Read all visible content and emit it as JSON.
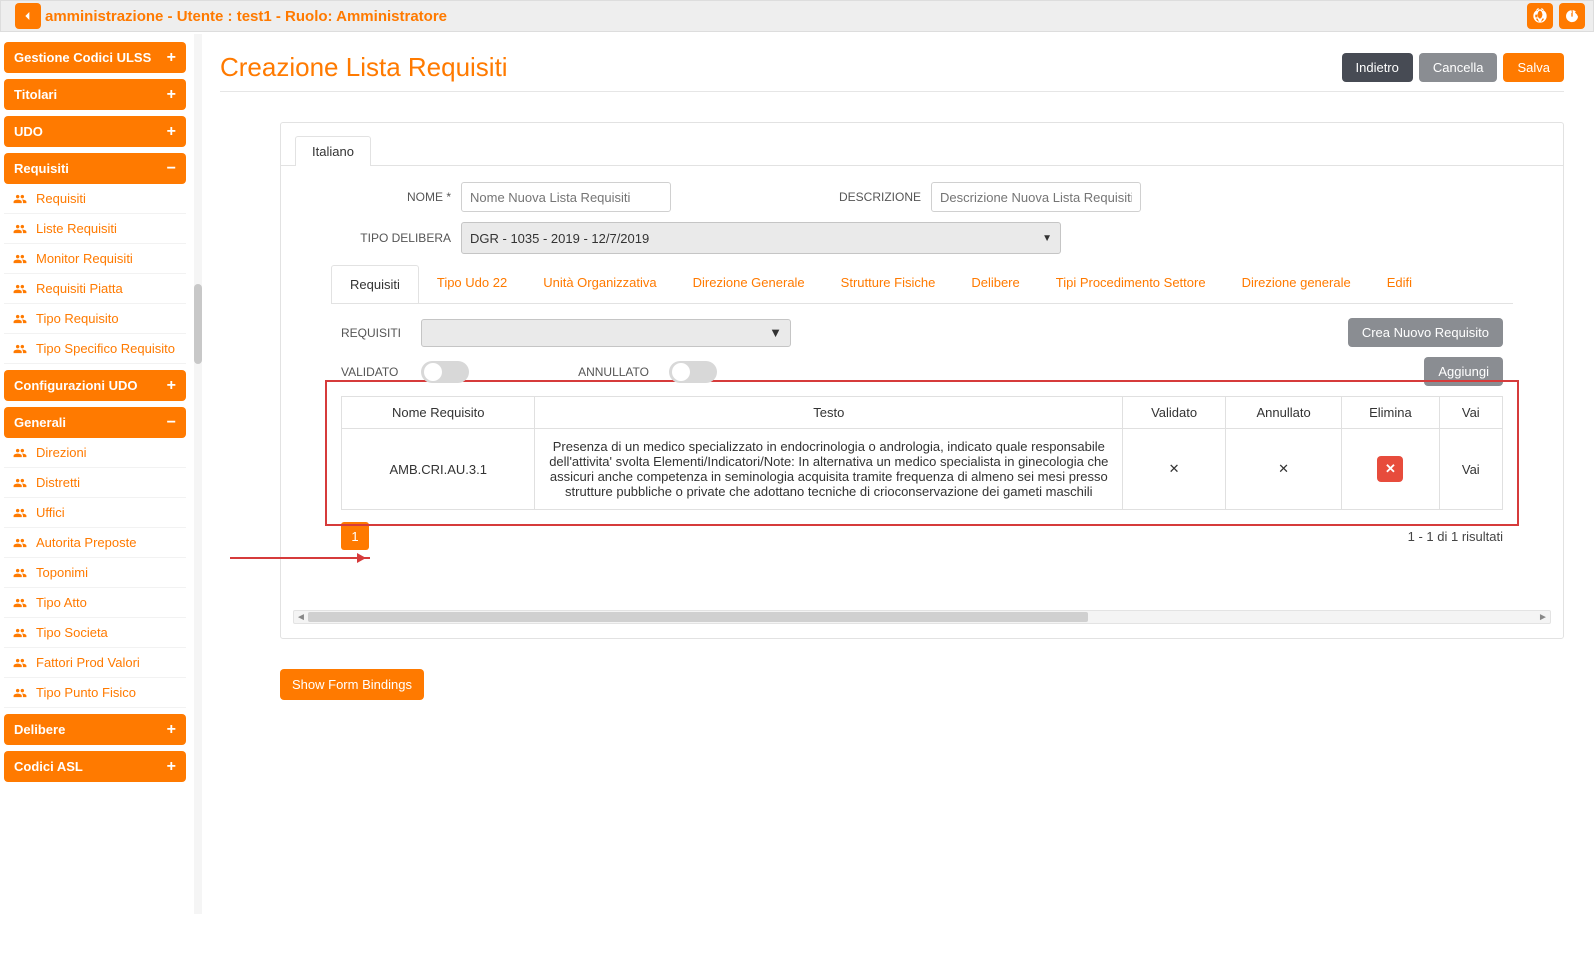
{
  "header": {
    "title": "amministrazione - Utente : test1 - Ruolo: Amministratore"
  },
  "sidebar": {
    "groups": [
      {
        "label": "Gestione Codici ULSS",
        "toggle": "+",
        "open": false,
        "items": []
      },
      {
        "label": "Titolari",
        "toggle": "+",
        "open": false,
        "items": []
      },
      {
        "label": "UDO",
        "toggle": "+",
        "open": false,
        "items": []
      },
      {
        "label": "Requisiti",
        "toggle": "−",
        "open": true,
        "items": [
          "Requisiti",
          "Liste Requisiti",
          "Monitor Requisiti",
          "Requisiti Piatta",
          "Tipo Requisito",
          "Tipo Specifico Requisito"
        ]
      },
      {
        "label": "Configurazioni UDO",
        "toggle": "+",
        "open": false,
        "items": []
      },
      {
        "label": "Generali",
        "toggle": "−",
        "open": true,
        "items": [
          "Direzioni",
          "Distretti",
          "Uffici",
          "Autorita Preposte",
          "Toponimi",
          "Tipo Atto",
          "Tipo Societa",
          "Fattori Prod Valori",
          "Tipo Punto Fisico"
        ]
      },
      {
        "label": "Delibere",
        "toggle": "+",
        "open": false,
        "items": []
      },
      {
        "label": "Codici ASL",
        "toggle": "+",
        "open": false,
        "items": []
      }
    ]
  },
  "page": {
    "title": "Creazione Lista Requisiti",
    "buttons": {
      "back": "Indietro",
      "cancel": "Cancella",
      "save": "Salva"
    },
    "lang_tab": "Italiano",
    "form": {
      "name_label": "NOME *",
      "name_placeholder": "Nome Nuova Lista Requisiti",
      "desc_label": "DESCRIZIONE",
      "desc_placeholder": "Descrizione Nuova Lista Requisiti",
      "tipo_label": "TIPO DELIBERA",
      "tipo_value": "DGR - 1035 - 2019 - 12/7/2019"
    },
    "tabs": [
      "Requisiti",
      "Tipo Udo 22",
      "Unità Organizzativa",
      "Direzione Generale",
      "Strutture Fisiche",
      "Delibere",
      "Tipi Procedimento Settore",
      "Direzione generale",
      "Edifi"
    ],
    "active_tab": 0,
    "filters": {
      "requisiti_label": "REQUISITI",
      "validato_label": "VALIDATO",
      "annullato_label": "ANNULLATO",
      "crea_btn": "Crea Nuovo Requisito",
      "aggiungi_btn": "Aggiungi"
    },
    "table": {
      "headers": [
        "Nome Requisito",
        "Testo",
        "Validato",
        "Annullato",
        "Elimina",
        "Vai"
      ],
      "rows": [
        {
          "nome": "AMB.CRI.AU.3.1",
          "testo": "Presenza di un medico specializzato in endocrinologia o andrologia, indicato quale responsabile dell'attivita' svolta Elementi/Indicatori/Note: In alternativa un medico specialista in ginecologia che assicuri anche competenza in seminologia acquisita tramite frequenza di almeno sei mesi presso strutture pubbliche o private che adottano tecniche di crioconservazione dei gameti maschili",
          "validato": "✕",
          "annullato": "✕",
          "vai": "Vai"
        }
      ]
    },
    "pagination": {
      "current": "1",
      "results": "1 - 1 di 1 risultati"
    },
    "show_bindings": "Show Form Bindings"
  }
}
